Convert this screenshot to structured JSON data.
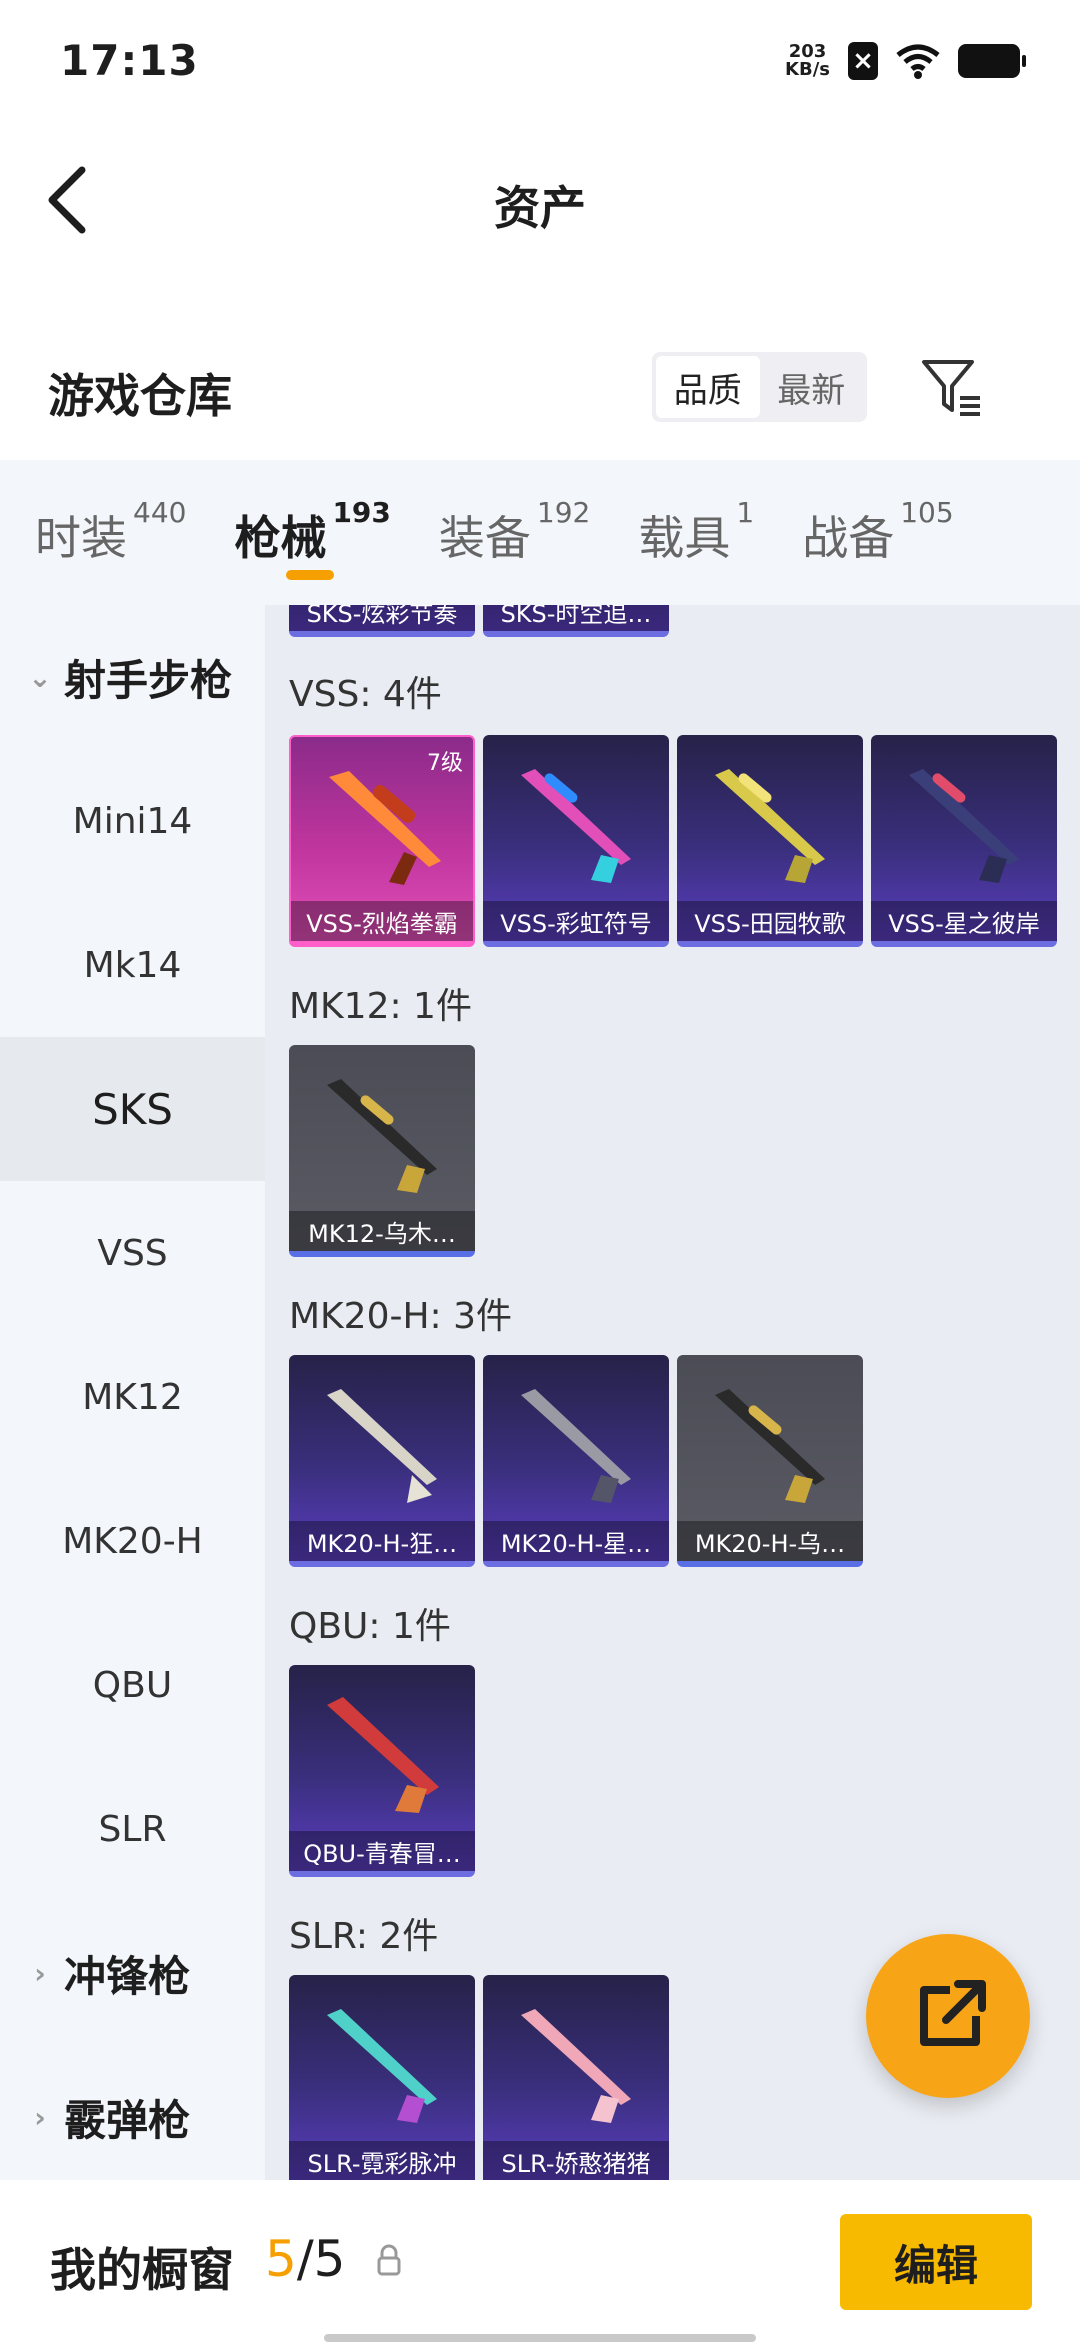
{
  "status": {
    "time": "17:13",
    "net_speed_value": "203",
    "net_speed_unit": "KB/s"
  },
  "title": "资产",
  "header": {
    "label": "游戏仓库",
    "sort_quality": "品质",
    "sort_newest": "最新"
  },
  "tabs": [
    {
      "label": "时装",
      "count": "440"
    },
    {
      "label": "枪械",
      "count": "193"
    },
    {
      "label": "装备",
      "count": "192"
    },
    {
      "label": "载具",
      "count": "1"
    },
    {
      "label": "战备",
      "count": "105"
    }
  ],
  "sidebar": {
    "category_open": "射手步枪",
    "items": [
      "Mini14",
      "Mk14",
      "SKS",
      "VSS",
      "MK12",
      "MK20-H",
      "QBU",
      "SLR"
    ],
    "selected": "SKS",
    "categories_closed": [
      "冲锋枪",
      "霰弹枪"
    ]
  },
  "content": {
    "top_partial": [
      "SKS-炫彩节奏",
      "SKS-时空追…"
    ],
    "groups": [
      {
        "title": "VSS: 4件",
        "items": [
          {
            "name": "VSS-烈焰拳霸",
            "level": "7级"
          },
          {
            "name": "VSS-彩虹符号"
          },
          {
            "name": "VSS-田园牧歌"
          },
          {
            "name": "VSS-星之彼岸"
          }
        ]
      },
      {
        "title": "MK12: 1件",
        "items": [
          {
            "name": "MK12-乌木…"
          }
        ]
      },
      {
        "title": "MK20-H: 3件",
        "items": [
          {
            "name": "MK20-H-狂…"
          },
          {
            "name": "MK20-H-星…"
          },
          {
            "name": "MK20-H-乌…"
          }
        ]
      },
      {
        "title": "QBU: 1件",
        "items": [
          {
            "name": "QBU-青春冒…"
          }
        ]
      },
      {
        "title": "SLR: 2件",
        "items": [
          {
            "name": "SLR-霓彩脉冲"
          },
          {
            "name": "SLR-娇憨猪猪"
          }
        ]
      }
    ]
  },
  "bottom": {
    "label": "我的橱窗",
    "count_current": "5",
    "count_sep": "/",
    "count_total": "5",
    "edit": "编辑"
  },
  "colors": {
    "accent": "#f5a000",
    "card_blue": "#3a2f7d",
    "card_pink": "#c0359e",
    "card_grey": "#5a5b64"
  }
}
